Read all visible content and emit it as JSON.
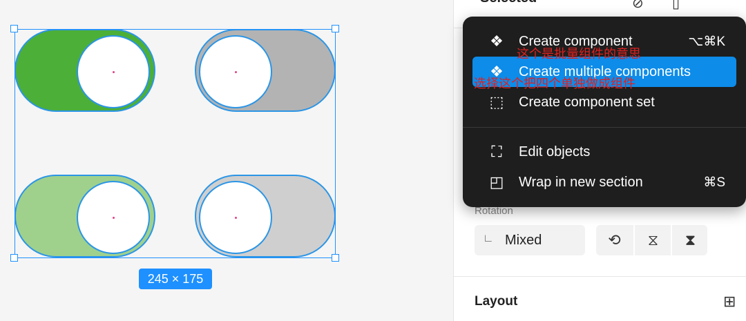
{
  "panel": {
    "title": "Selected",
    "rotation_label": "Rotation",
    "rotation_value": "Mixed",
    "layout_label": "Layout"
  },
  "canvas": {
    "dimensions": "245 × 175",
    "toggles": [
      {
        "state": "on",
        "track_color": "#4caf37"
      },
      {
        "state": "off",
        "track_color": "#b3b3b3"
      },
      {
        "state": "on-light",
        "track_color": "#9fd18d"
      },
      {
        "state": "off-light",
        "track_color": "#cfcfcf"
      }
    ]
  },
  "menu": {
    "items": [
      {
        "icon": "component-icon",
        "label": "Create component",
        "shortcut": "⌥⌘K",
        "highlighted": false
      },
      {
        "icon": "multiple-components-icon",
        "label": "Create multiple components",
        "shortcut": "",
        "highlighted": true
      },
      {
        "icon": "component-set-icon",
        "label": "Create component set",
        "shortcut": "",
        "highlighted": false
      },
      {
        "icon": "edit-objects-icon",
        "label": "Edit objects",
        "shortcut": "",
        "highlighted": false
      },
      {
        "icon": "section-icon",
        "label": "Wrap in new section",
        "shortcut": "⌘S",
        "highlighted": false
      }
    ]
  },
  "annotations": {
    "line1": "这个是批量组件的意思",
    "line2": "选择这个把四个单独做成组件"
  },
  "colors": {
    "accent": "#0d8ce9",
    "selection": "#1e90ff",
    "annotation": "#e02020"
  }
}
